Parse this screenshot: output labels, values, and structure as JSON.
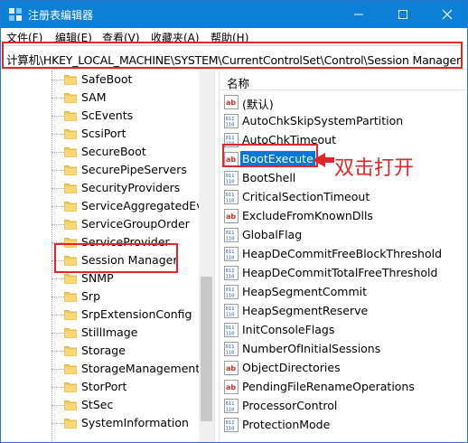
{
  "window": {
    "title": "注册表编辑器"
  },
  "menu": [
    {
      "label": "文件(F)"
    },
    {
      "label": "编辑(E)"
    },
    {
      "label": "查看(V)"
    },
    {
      "label": "收藏夹(A)"
    },
    {
      "label": "帮助(H)"
    }
  ],
  "address": {
    "path": "计算机\\HKEY_LOCAL_MACHINE\\SYSTEM\\CurrentControlSet\\Control\\Session Manager"
  },
  "tree": {
    "items": [
      {
        "label": "SafeBoot"
      },
      {
        "label": "SAM"
      },
      {
        "label": "ScEvents"
      },
      {
        "label": "ScsiPort"
      },
      {
        "label": "SecureBoot"
      },
      {
        "label": "SecurePipeServers"
      },
      {
        "label": "SecurityProviders"
      },
      {
        "label": "ServiceAggregatedEve"
      },
      {
        "label": "ServiceGroupOrder"
      },
      {
        "label": "ServiceProvider"
      },
      {
        "label": "Session Manager"
      },
      {
        "label": "SNMP"
      },
      {
        "label": "Srp"
      },
      {
        "label": "SrpExtensionConfig"
      },
      {
        "label": "StillImage"
      },
      {
        "label": "Storage"
      },
      {
        "label": "StorageManagement"
      },
      {
        "label": "StorPort"
      },
      {
        "label": "StSec"
      },
      {
        "label": "SystemInformation"
      }
    ],
    "selected_index": 10
  },
  "values": {
    "column_name": "名称",
    "items": [
      {
        "label": "(默认)",
        "type": "string"
      },
      {
        "label": "AutoChkSkipSystemPartition",
        "type": "binary"
      },
      {
        "label": "AutoChkTimeout",
        "type": "binary"
      },
      {
        "label": "BootExecute",
        "type": "string"
      },
      {
        "label": "BootShell",
        "type": "binary"
      },
      {
        "label": "CriticalSectionTimeout",
        "type": "binary"
      },
      {
        "label": "ExcludeFromKnownDlls",
        "type": "string"
      },
      {
        "label": "GlobalFlag",
        "type": "binary"
      },
      {
        "label": "HeapDeCommitFreeBlockThreshold",
        "type": "binary"
      },
      {
        "label": "HeapDeCommitTotalFreeThreshold",
        "type": "binary"
      },
      {
        "label": "HeapSegmentCommit",
        "type": "binary"
      },
      {
        "label": "HeapSegmentReserve",
        "type": "binary"
      },
      {
        "label": "InitConsoleFlags",
        "type": "binary"
      },
      {
        "label": "NumberOfInitialSessions",
        "type": "binary"
      },
      {
        "label": "ObjectDirectories",
        "type": "string"
      },
      {
        "label": "PendingFileRenameOperations",
        "type": "string"
      },
      {
        "label": "ProcessorControl",
        "type": "binary"
      },
      {
        "label": "ProtectionMode",
        "type": "binary"
      }
    ],
    "selected_index": 3
  },
  "annotation": {
    "text": "双击打开",
    "color": "#e3262b"
  },
  "colors": {
    "titlebar": "#0e7fd7",
    "selection": "#0078d7",
    "highlight": "#e3262b",
    "folder": "#f5c650"
  }
}
